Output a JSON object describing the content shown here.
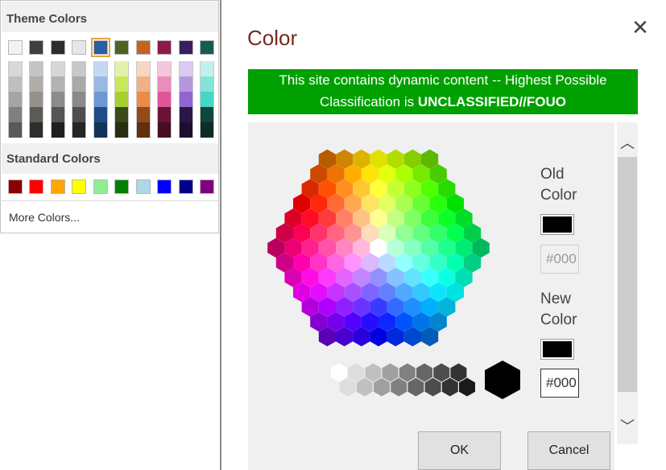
{
  "palette": {
    "theme_title": "Theme Colors",
    "standard_title": "Standard Colors",
    "more_colors": "More Colors...",
    "theme_top": [
      "#f2f2f2",
      "#3f3f3f",
      "#2d2d2d",
      "#e6e6e6",
      "#2b5fa3",
      "#4e6222",
      "#c5631c",
      "#8e1b4a",
      "#3a1e5f",
      "#175c52"
    ],
    "theme_shades": [
      [
        "#d8d8d8",
        "#bfbfbf",
        "#a5a5a5",
        "#7f7f7f",
        "#595959"
      ],
      [
        "#c4c4c4",
        "#b0ada7",
        "#94918a",
        "#5c5a55",
        "#2f2d29"
      ],
      [
        "#d6d6d6",
        "#b2b2b2",
        "#8c8c8c",
        "#555555",
        "#1f1f1f"
      ],
      [
        "#c8c8c8",
        "#a9a9a9",
        "#8a8a8a",
        "#4e4e4e",
        "#262626"
      ],
      [
        "#c6d8f0",
        "#9ab8e3",
        "#6e98d5",
        "#204b86",
        "#15325a"
      ],
      [
        "#e2f2a8",
        "#c7e85a",
        "#a6d12b",
        "#3a4a18",
        "#262f10"
      ],
      [
        "#f7d7c0",
        "#f0b184",
        "#e88c48",
        "#94491a",
        "#622f10"
      ],
      [
        "#f5c6dc",
        "#ea8dba",
        "#e05597",
        "#6b1437",
        "#470d24"
      ],
      [
        "#dacbf0",
        "#b597e0",
        "#9164d2",
        "#2b1648",
        "#1d0f30"
      ],
      [
        "#c1f1eb",
        "#84e4d8",
        "#46d6c5",
        "#11453d",
        "#0b2e29"
      ]
    ],
    "standard": [
      "#8b0000",
      "#ff0000",
      "#ffa500",
      "#ffff00",
      "#90ee90",
      "#008000",
      "#add8e6",
      "#0000ff",
      "#00008b",
      "#800080"
    ]
  },
  "dialog": {
    "title": "Color",
    "close_glyph": "✕",
    "banner_line1": "This site contains dynamic content -- Highest Possible",
    "banner_line2_prefix": "Classification is ",
    "banner_line2_bold": "UNCLASSIFIED//FOUO",
    "old_color_label_1": "Old",
    "old_color_label_2": "Color",
    "old_color_value": "#000000",
    "new_color_label_1": "New",
    "new_color_label_2": "Color",
    "new_color_value": "#000000",
    "old_hex_text": "#000",
    "new_hex_text": "#000",
    "ok_label": "OK",
    "cancel_label": "Cancel",
    "scroll_up_glyph": "︿",
    "scroll_down_glyph": "﹀",
    "icons": [
      "close-icon",
      "chevron-up-icon",
      "chevron-down-icon"
    ]
  }
}
